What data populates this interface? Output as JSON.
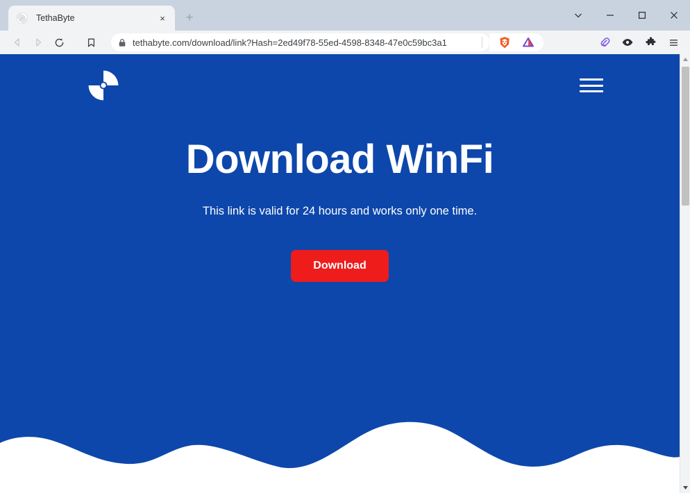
{
  "browser": {
    "tab": {
      "title": "TethaByte",
      "favicon_icon": "tethabyte-disc-icon",
      "close_icon": "close-icon",
      "close_label": "×"
    },
    "new_tab": {
      "icon": "plus-icon",
      "label": "+"
    },
    "window_controls": [
      {
        "name": "tab-search-button",
        "icon": "chevron-down-icon"
      },
      {
        "name": "minimize-button",
        "icon": "minimize-icon"
      },
      {
        "name": "maximize-button",
        "icon": "maximize-icon"
      },
      {
        "name": "close-window-button",
        "icon": "close-icon"
      }
    ],
    "toolbar": {
      "back_icon": "back-arrow-icon",
      "forward_icon": "forward-arrow-icon",
      "reload_icon": "reload-icon",
      "bookmark_icon": "bookmark-icon",
      "lock_icon": "lock-icon",
      "url": "tethabyte.com/download/link?Hash=2ed49f78-55ed-4598-8348-47e0c59bc3a1",
      "shield_icon": "brave-lion-shield-icon",
      "triangle_icon": "purple-triangle-icon",
      "right_icons": [
        {
          "name": "clipboard-extension-icon",
          "icon": "paperclip-icon"
        },
        {
          "name": "eye-extension-icon",
          "icon": "eye-icon"
        },
        {
          "name": "extensions-button",
          "icon": "puzzle-piece-icon"
        },
        {
          "name": "browser-menu-button",
          "icon": "hamburger-menu-icon"
        }
      ]
    },
    "scrollbar": {
      "up_icon": "scroll-up-arrow-icon",
      "down_icon": "scroll-down-arrow-icon"
    }
  },
  "page": {
    "logo_icon": "tethabyte-wifi-disc-logo",
    "menu_icon": "hamburger-menu-icon",
    "hero": {
      "title": "Download WinFi",
      "subtitle": "This link is valid for 24 hours and works only one time.",
      "download_label": "Download"
    }
  },
  "colors": {
    "page_background": "#0d47ac",
    "download_button": "#ef1c1c",
    "text_on_blue": "#ffffff",
    "wave": "#ffffff",
    "browser_chrome": "#f2f3f5",
    "tabstrip": "#c9d3e0"
  }
}
